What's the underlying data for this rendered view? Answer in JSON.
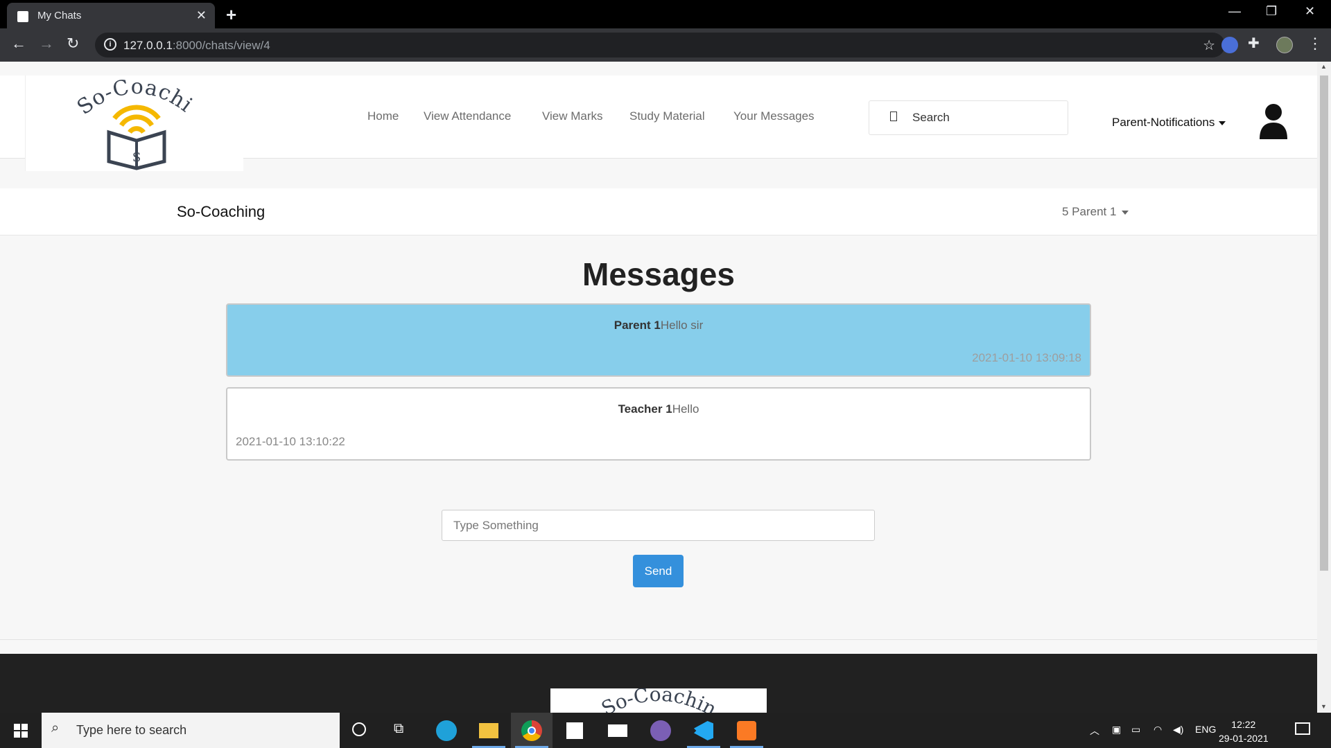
{
  "browser": {
    "tab_title": "My Chats",
    "url_host": "127.0.0.1",
    "url_path": ":8000/chats/view/4"
  },
  "header": {
    "logo_text": "So-Coaching",
    "logo_letter": "S",
    "nav": [
      "Home",
      "View Attendance",
      "View Marks",
      "Study Material",
      "Your Messages"
    ],
    "search_label": "Search",
    "notifications_label": "Parent-Notifications"
  },
  "subnav": {
    "brand": "So-Coaching",
    "user_label": "5 Parent 1"
  },
  "main": {
    "heading": "Messages",
    "messages": [
      {
        "sender": "Parent 1",
        "text": "Hello sir",
        "timestamp": "2021-01-10 13:09:18"
      },
      {
        "sender": "Teacher 1",
        "text": "Hello",
        "timestamp": "2021-01-10 13:10:22"
      }
    ],
    "input_placeholder": "Type Something",
    "send_label": "Send"
  },
  "footer": {
    "logo_text": "So-Coaching"
  },
  "taskbar": {
    "search_placeholder": "Type here to search",
    "language": "ENG",
    "time": "12:22",
    "date": "29-01-2021"
  },
  "colors": {
    "own_message_bg": "#87ceeb",
    "send_button": "#3490dc",
    "logo_yellow": "#f5b800",
    "logo_dark": "#3b4452"
  }
}
